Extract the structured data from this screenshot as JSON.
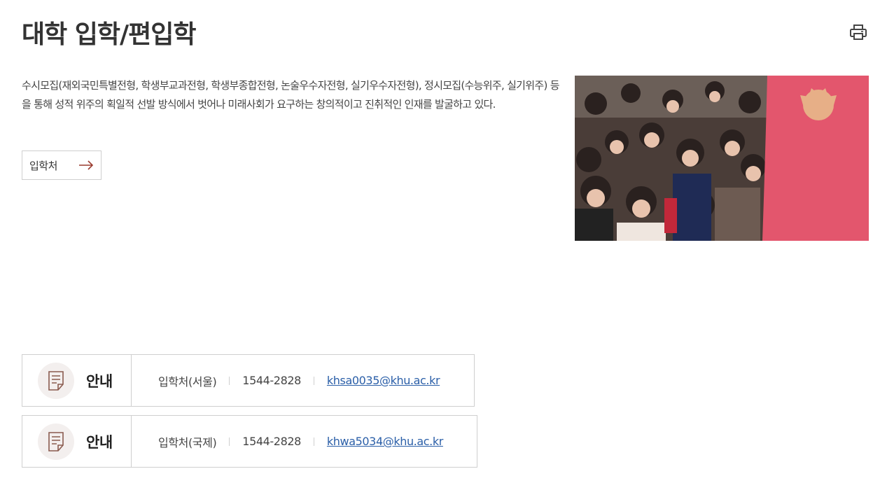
{
  "page": {
    "title": "대학 입학/편입학",
    "description": "수시모집(재외국민특별전형, 학생부교과전형, 학생부종합전형, 논술우수자전형, 실기우수자전형), 정시모집(수능위주, 실기위주) 등을 통해 성적 위주의 획일적 선발 방식에서 벗어나 미래사회가 요구하는 창의적이고 진취적인 인재를 발굴하고 있다.",
    "link_label": "입학처"
  },
  "icons": {
    "print": "printer-icon",
    "arrow": "arrow-right-icon",
    "document": "document-icon"
  },
  "colors": {
    "accent": "#9a3a2e",
    "link": "#2b5fa8",
    "banner": "#e3566d"
  },
  "info": [
    {
      "heading": "안내",
      "office": "입학처(서울)",
      "phone": "1544-2828",
      "email": "khsa0035@khu.ac.kr"
    },
    {
      "heading": "안내",
      "office": "입학처(국제)",
      "phone": "1544-2828",
      "email": "khwa5034@khu.ac.kr"
    }
  ]
}
